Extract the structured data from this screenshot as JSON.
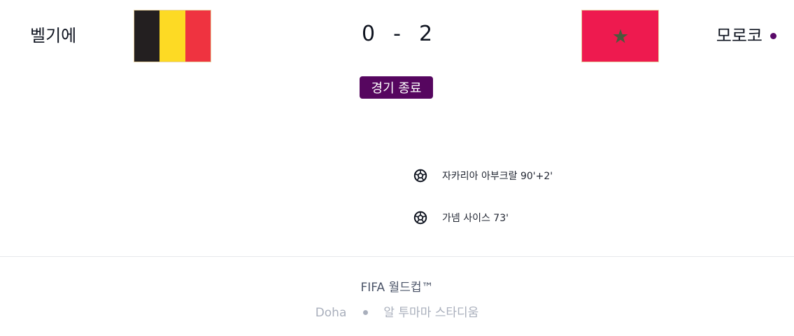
{
  "match": {
    "home": {
      "name": "벨기에",
      "flag_colors": [
        "#231f20",
        "#fdda24",
        "#ef3340"
      ]
    },
    "away": {
      "name": "모로코",
      "flag_color": "#ee1a4f",
      "flag_star_color": "#4a5a3c"
    },
    "score": {
      "home": "0",
      "separator": "-",
      "away": "2"
    },
    "status": "경기 종료",
    "possession_indicator_color": "#5a0a69"
  },
  "goals": [
    {
      "icon": "soccer-ball-icon",
      "text": "자카리아 아부크랄 90'+2'"
    },
    {
      "icon": "soccer-ball-icon",
      "text": "가넴 사이스 73'"
    }
  ],
  "footer": {
    "competition": "FIFA 월드컵™",
    "city": "Doha",
    "stadium": "알 투마마 스타디움"
  },
  "colors": {
    "brand_purple": "#56065f",
    "text_dark": "#0f1420",
    "text_muted": "#a9afbc",
    "divider": "#e6e8ec"
  }
}
